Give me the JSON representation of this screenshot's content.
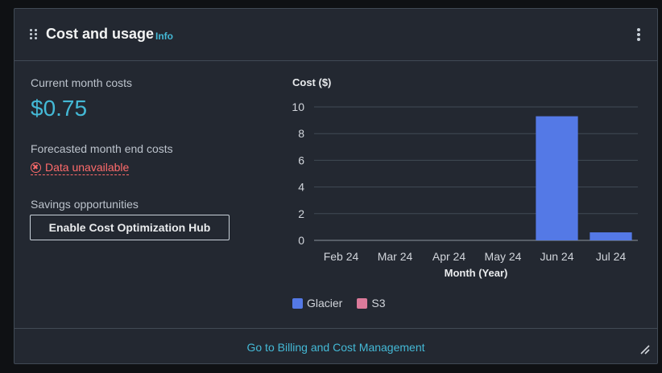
{
  "widget": {
    "title": "Cost and usage",
    "info_label": "Info",
    "drag_icon": "drag-handle-icon",
    "menu_icon": "more-vertical-icon"
  },
  "summary": {
    "current_label": "Current month costs",
    "current_value": "$0.75",
    "forecast_label": "Forecasted month end costs",
    "forecast_status": "Data unavailable",
    "forecast_status_icon": "error-circle-icon",
    "savings_label": "Savings opportunities",
    "savings_button": "Enable Cost Optimization Hub"
  },
  "chart_data": {
    "type": "bar",
    "title": "Cost ($)",
    "xlabel": "Month (Year)",
    "ylabel": "Cost ($)",
    "categories": [
      "Feb 24",
      "Mar 24",
      "Apr 24",
      "May 24",
      "Jun 24",
      "Jul 24"
    ],
    "series": [
      {
        "name": "Glacier",
        "color": "#5479e6",
        "values": [
          0,
          0,
          0,
          0,
          9.3,
          0.6
        ]
      },
      {
        "name": "S3",
        "color": "#db7a9a",
        "values": [
          0,
          0,
          0,
          0,
          0,
          0
        ]
      }
    ],
    "ylim": [
      0,
      10
    ],
    "yticks": [
      0,
      2,
      4,
      6,
      8,
      10
    ],
    "grid": true,
    "legend": "bottom-left"
  },
  "footer": {
    "link_label": "Go to Billing and Cost Management",
    "resize_icon": "resize-handle-icon"
  },
  "colors": {
    "accent": "#44b9d6",
    "error": "#ff6b6b",
    "card_bg": "#232831"
  }
}
